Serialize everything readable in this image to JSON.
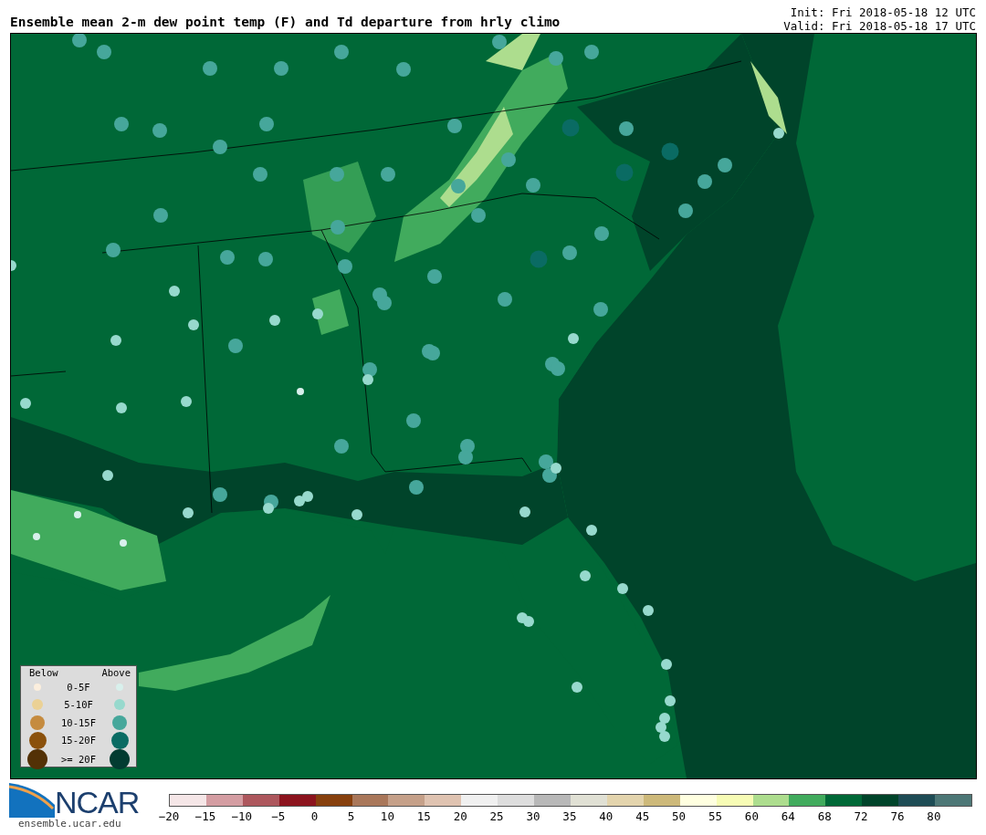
{
  "title": "Ensemble mean 2-m dew point temp (F) and Td departure from hrly climo",
  "init": "Init: Fri 2018-05-18 12 UTC",
  "valid": "Valid: Fri 2018-05-18 17 UTC",
  "legend": {
    "below_heading": "Below",
    "above_heading": "Above",
    "rows": [
      {
        "label": "0-5F",
        "below": {
          "color": "#fbeedd"
        },
        "above": {
          "color": "#d8f0ec"
        }
      },
      {
        "label": "5-10F",
        "below": {
          "color": "#ebd195"
        },
        "above": {
          "color": "#97d9cd"
        }
      },
      {
        "label": "10-15F",
        "below": {
          "color": "#c58b3f"
        },
        "above": {
          "color": "#46a79b"
        }
      },
      {
        "label": "15-20F",
        "below": {
          "color": "#8b510b"
        },
        "above": {
          "color": "#0a6b63"
        }
      },
      {
        "label": ">= 20F",
        "below": {
          "color": "#533106"
        },
        "above": {
          "color": "#023c31"
        }
      }
    ]
  },
  "logo": {
    "text": "NCAR",
    "url": "ensemble.ucar.edu"
  },
  "colorbar": {
    "segments": [
      {
        "color": "#f5e6e7"
      },
      {
        "color": "#d49da2"
      },
      {
        "color": "#ad575d"
      },
      {
        "color": "#8c141e"
      },
      {
        "color": "#87400e"
      },
      {
        "color": "#a9775a"
      },
      {
        "color": "#c5a089"
      },
      {
        "color": "#dfc3b1"
      },
      {
        "color": "#f0f0f0"
      },
      {
        "color": "#dddddd"
      },
      {
        "color": "#b8b8b8"
      },
      {
        "color": "#e0e0d4"
      },
      {
        "color": "#e3d4ad"
      },
      {
        "color": "#cdb97a"
      },
      {
        "color": "#ffffe0"
      },
      {
        "color": "#f7fcb5"
      },
      {
        "color": "#addd8e"
      },
      {
        "color": "#41ab5d"
      },
      {
        "color": "#006837"
      },
      {
        "color": "#00442a"
      },
      {
        "color": "#1e4c55"
      },
      {
        "color": "#4d7776"
      }
    ],
    "ticks": [
      "−20",
      "−15",
      "−10",
      "−5",
      "0",
      "5",
      "10",
      "15",
      "20",
      "25",
      "30",
      "35",
      "40",
      "45",
      "50",
      "55",
      "60",
      "64",
      "68",
      "72",
      "76",
      "80"
    ]
  }
}
